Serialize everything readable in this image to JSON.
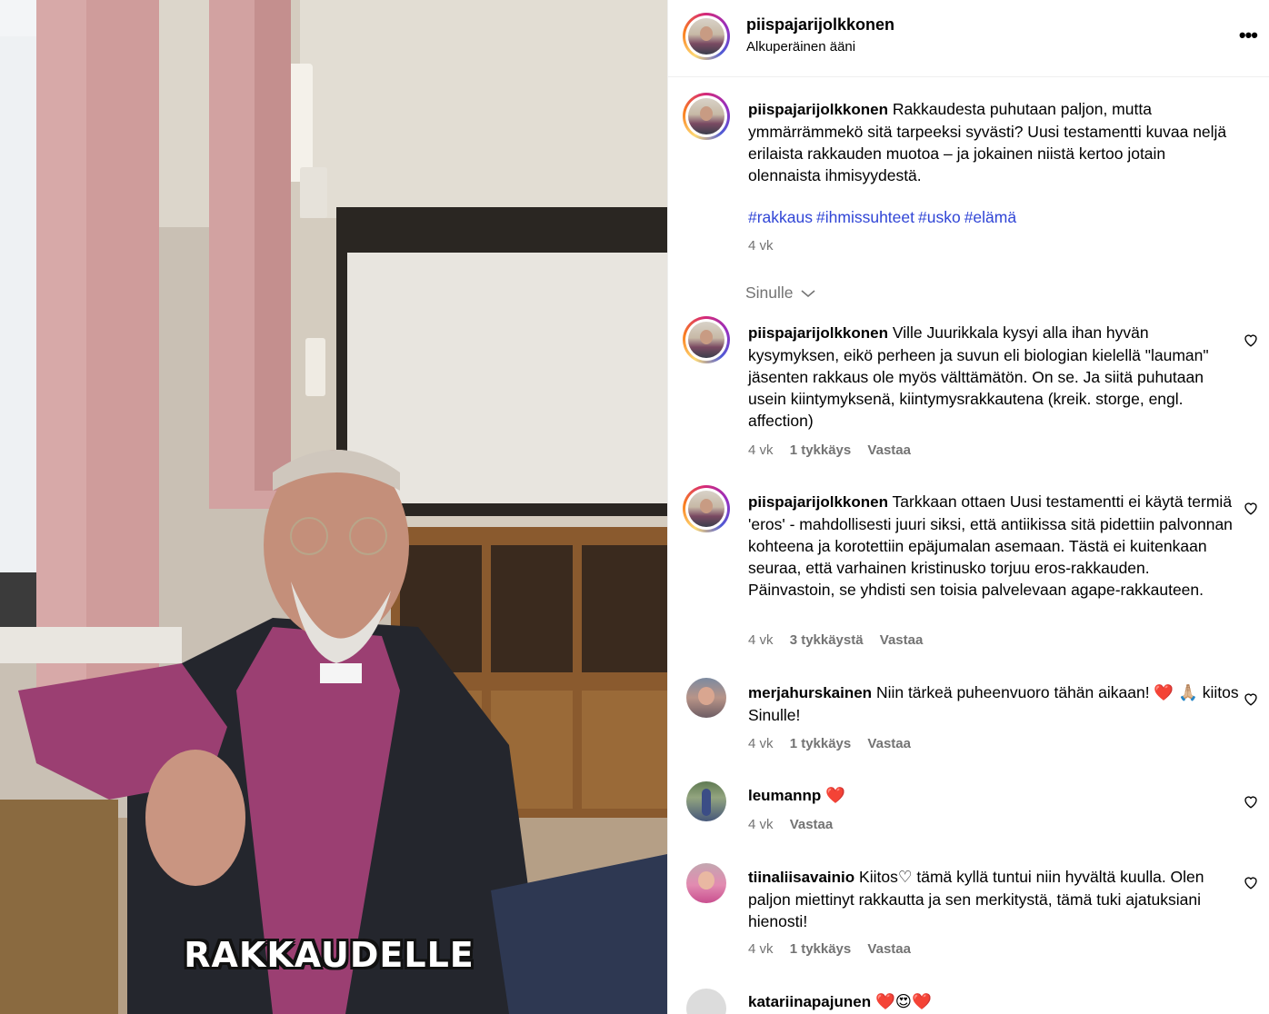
{
  "video": {
    "caption": "RAKKAUDELLE"
  },
  "header": {
    "username": "piispajarijolkkonen",
    "audio": "Alkuperäinen ääni",
    "more_icon": "more-options-icon"
  },
  "post": {
    "username": "piispajarijolkkonen",
    "text": "Rakkaudesta puhutaan paljon, mutta ymmärrämmekö sitä tarpeeksi syvästi? Uusi testamentti kuvaa neljä erilaista rakkauden muotoa – ja jokainen niistä kertoo jotain olennaista ihmisyydestä.",
    "hashtags": [
      "#rakkaus",
      "#ihmissuhteet",
      "#usko",
      "#elämä"
    ],
    "time": "4 vk"
  },
  "sort": {
    "label": "Sinulle"
  },
  "comments": [
    {
      "username": "piispajarijolkkonen",
      "text": "Ville Juurikkala kysyi alla ihan hyvän kysymyksen, eikö perheen ja suvun eli biologian kielellä \"lauman\" jäsenten rakkaus ole myös välttämätön. On se. Ja siitä puhutaan usein kiintymyksenä, kiintymysrakkautena (kreik. storge, engl. affection)",
      "time": "4 vk",
      "likes": "1 tykkäys",
      "reply": "Vastaa"
    },
    {
      "username": "piispajarijolkkonen",
      "text": "Tarkkaan ottaen Uusi testamentti ei käytä termiä 'eros' - mahdollisesti juuri siksi, että antiikissa sitä pidettiin palvonnan kohteena ja korotettiin epäjumalan asemaan. Tästä ei kuitenkaan seuraa, että varhainen kristinusko torjuu eros-rakkauden. Päinvastoin, se yhdisti sen toisia palvelevaan agape-rakkauteen.",
      "time": "4 vk",
      "likes": "3 tykkäystä",
      "reply": "Vastaa"
    },
    {
      "username": "merjahurskainen",
      "text": "Niin tärkeä puheenvuoro tähän aikaan! ❤️ 🙏🏼 kiitos Sinulle!",
      "time": "4 vk",
      "likes": "1 tykkäys",
      "reply": "Vastaa"
    },
    {
      "username": "leumannp",
      "text": "❤️",
      "time": "4 vk",
      "likes": "",
      "reply": "Vastaa"
    },
    {
      "username": "tiinaliisavainio",
      "text": "Kiitos♡ tämä kyllä tuntui niin hyvältä kuulla. Olen paljon miettinyt rakkautta ja sen merkitystä, tämä tuki ajatuksiani hienosti!",
      "time": "4 vk",
      "likes": "1 tykkäys",
      "reply": "Vastaa"
    },
    {
      "username": "katariinapajunen",
      "text": "❤️😍❤️",
      "time": "",
      "likes": "",
      "reply": ""
    }
  ]
}
